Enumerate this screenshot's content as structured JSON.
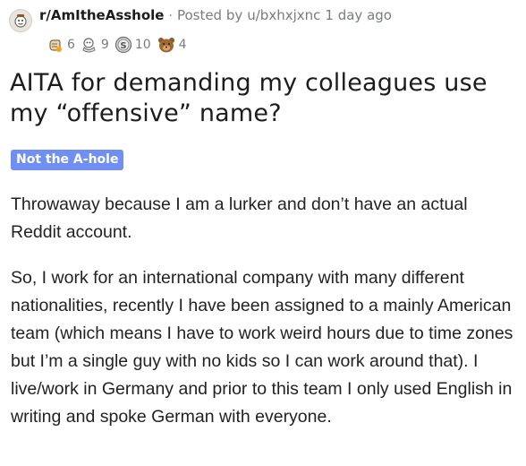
{
  "header": {
    "subreddit": "r/AmItheAsshole",
    "separator": "·",
    "posted_by_prefix": "Posted by",
    "username": "u/bxhxjxnc",
    "time": "1 day ago"
  },
  "awards": [
    {
      "icon": "wholesome-award-icon",
      "count": "6"
    },
    {
      "icon": "hugz-award-icon",
      "count": "9"
    },
    {
      "icon": "silver-award-icon",
      "count": "10"
    },
    {
      "icon": "bear-award-icon",
      "count": "4"
    }
  ],
  "post": {
    "title": "AITA for demanding my colleagues use my “offensive” name?",
    "flair": "Not the A-hole",
    "paragraphs": [
      "Throwaway because I am a lurker and don’t have an actual Reddit account.",
      "So, I work for an international company with many different nationalities, recently I have been assigned to a mainly American team (which means I have to work weird hours due to time zones but I’m a single guy with no kids so I can work around that). I live/work in Germany and prior to this team I only used English in writing and spoke German with everyone."
    ]
  },
  "colors": {
    "flair_background": "#6f8ff2",
    "text": "#1c1c1c",
    "meta_text": "#787c7e"
  }
}
